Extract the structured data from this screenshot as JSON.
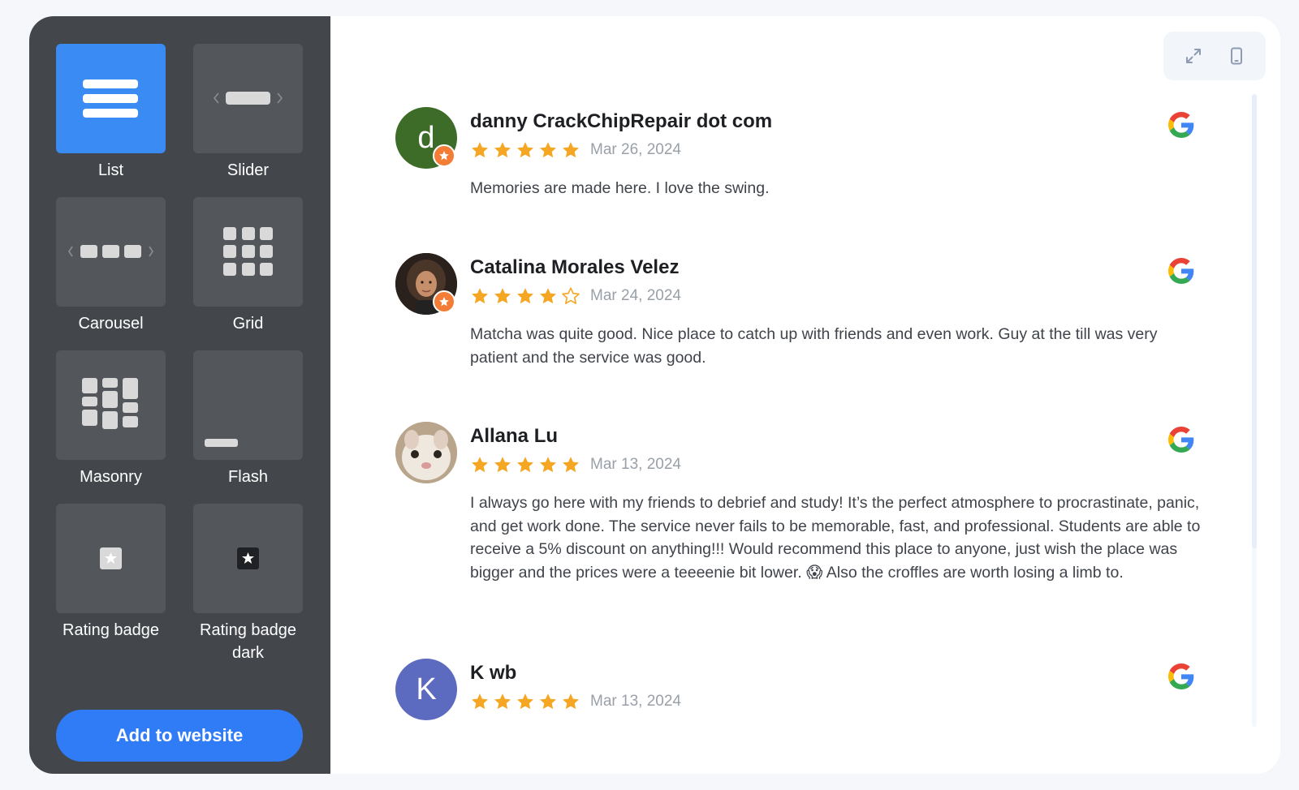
{
  "sidebar": {
    "layouts": [
      {
        "id": "list",
        "label": "List",
        "active": true,
        "icon": "list-layout-icon"
      },
      {
        "id": "slider",
        "label": "Slider",
        "active": false,
        "icon": "slider-layout-icon"
      },
      {
        "id": "carousel",
        "label": "Carousel",
        "active": false,
        "icon": "carousel-layout-icon"
      },
      {
        "id": "grid",
        "label": "Grid",
        "active": false,
        "icon": "grid-layout-icon"
      },
      {
        "id": "masonry",
        "label": "Masonry",
        "active": false,
        "icon": "masonry-layout-icon"
      },
      {
        "id": "flash",
        "label": "Flash",
        "active": false,
        "icon": "flash-layout-icon"
      },
      {
        "id": "rating-badge",
        "label": "Rating badge",
        "active": false,
        "icon": "rating-badge-icon"
      },
      {
        "id": "rating-badge-dark",
        "label": "Rating badge dark",
        "active": false,
        "icon": "rating-badge-dark-icon"
      }
    ],
    "add_button_label": "Add to website"
  },
  "toolbar": {
    "expand_icon": "expand-icon",
    "mobile_icon": "mobile-device-icon"
  },
  "reviews": [
    {
      "name": "danny CrackChipRepair dot com",
      "rating": 5,
      "date": "Mar 26, 2024",
      "text": "Memories are made here. I love the swing.",
      "avatar_letter": "d",
      "avatar_color": "#3d6b28",
      "local_guide": true
    },
    {
      "name": "Catalina Morales Velez",
      "rating": 4,
      "date": "Mar 24, 2024",
      "text": "Matcha was quite good. Nice place to catch up with friends and even work. Guy at the till was very patient and the service was good.",
      "avatar_letter": "",
      "avatar_color": "#3a2e26",
      "local_guide": true
    },
    {
      "name": "Allana Lu",
      "rating": 5,
      "date": "Mar 13, 2024",
      "text": "I always go here with my friends to debrief and study! It’s the perfect atmosphere to procrastinate, panic, and get work done. The service never fails to be memorable, fast, and professional. Students are able to receive a 5% discount on anything!!! Would recommend this place to anyone, just wish the place was bigger and the prices were a teeeenie bit lower. 😱 Also the croffles are worth losing a limb to.",
      "avatar_letter": "",
      "avatar_color": "#c9b49a",
      "local_guide": false
    },
    {
      "name": "K wb",
      "rating": 5,
      "date": "Mar 13, 2024",
      "text": "",
      "avatar_letter": "K",
      "avatar_color": "#5c6bc0",
      "local_guide": false
    }
  ],
  "colors": {
    "sidebar_bg": "#43474c",
    "tile_bg": "#53575c",
    "accent": "#2f7cf6",
    "star": "#f5a623",
    "guide_badge": "#f37c37"
  },
  "review_source_icon": "google-logo-icon"
}
